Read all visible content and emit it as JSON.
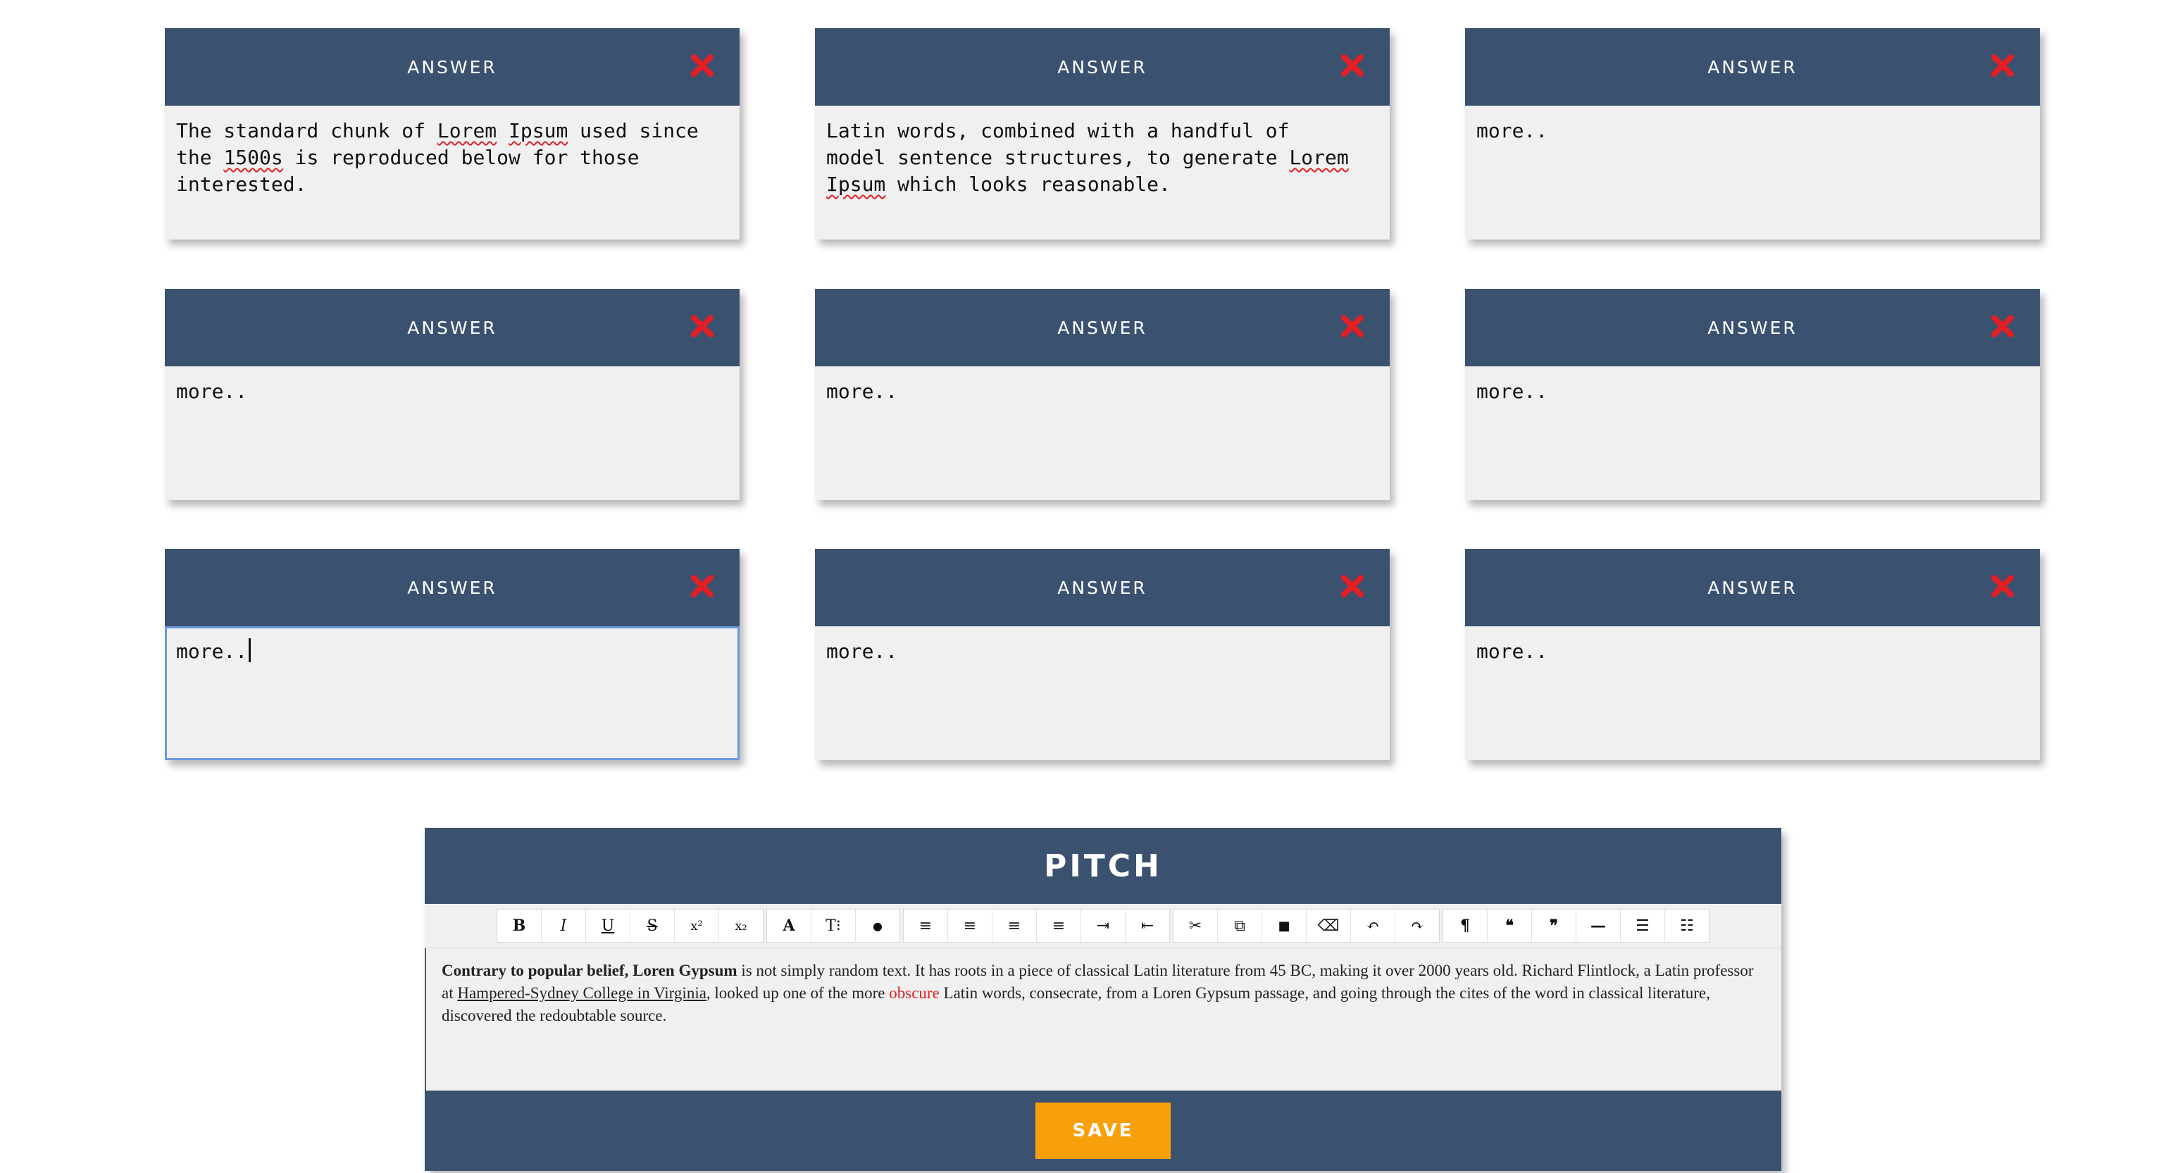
{
  "cards": [
    {
      "title": "ANSWER",
      "body_parts": [
        "The standard chunk of ",
        "Lorem",
        " ",
        "Ipsum",
        " used since\nthe ",
        "1500s",
        " is reproduced below for those\ninterested."
      ]
    },
    {
      "title": "ANSWER",
      "body_parts": [
        "Latin words, combined with a handful of\nmodel sentence structures, to generate ",
        "Lorem",
        "\n",
        "Ipsum",
        " which looks reasonable."
      ]
    },
    {
      "title": "ANSWER",
      "text": "more.."
    },
    {
      "title": "ANSWER",
      "text": "more.."
    },
    {
      "title": "ANSWER",
      "text": "more.."
    },
    {
      "title": "ANSWER",
      "text": "more.."
    },
    {
      "title": "ANSWER",
      "text": "more.."
    },
    {
      "title": "ANSWER",
      "text": "more.."
    },
    {
      "title": "ANSWER",
      "text": "more.."
    }
  ],
  "pitch": {
    "title": "PITCH",
    "body": {
      "bold": "Contrary to popular belief, Loren Gypsum",
      "text1": " is not simply random text. It has roots in a piece of classical Latin literature from 45 BC, making it over 2000 years old. Richard Flintlock, a Latin professor at ",
      "link": "Hampered-Sydney College in Virginia",
      "text2": ", looked up one of the more ",
      "red": "obscure",
      "text3": " Latin words, consecrate, from a Loren Gypsum passage, and going through the cites of the word in classical literature, discovered the redoubtable source."
    },
    "save_label": "SAVE"
  },
  "toolbar_icons": [
    [
      "bold-icon",
      "B"
    ],
    [
      "italic-icon",
      "I"
    ],
    [
      "underline-icon",
      "U"
    ],
    [
      "strikethrough-icon",
      "S"
    ],
    [
      "superscript-icon",
      "x²"
    ],
    [
      "subscript-icon",
      "x₂"
    ],
    [
      "font-color-icon",
      "A"
    ],
    [
      "text-size-icon",
      "T⁝"
    ],
    [
      "highlight-icon",
      "●"
    ],
    [
      "align-left-icon",
      "≡"
    ],
    [
      "align-center-icon",
      "≡"
    ],
    [
      "align-right-icon",
      "≡"
    ],
    [
      "justify-icon",
      "≡"
    ],
    [
      "indent-icon",
      "⇥"
    ],
    [
      "outdent-icon",
      "⇤"
    ],
    [
      "cut-icon",
      "✂"
    ],
    [
      "copy-icon",
      "⧉"
    ],
    [
      "delete-icon",
      "🗑"
    ],
    [
      "eraser-icon",
      "⌫"
    ],
    [
      "undo-icon",
      "↶"
    ],
    [
      "redo-icon",
      "↷"
    ],
    [
      "paragraph-icon",
      "¶"
    ],
    [
      "quote-open-icon",
      "❝"
    ],
    [
      "quote-close-icon",
      "❞"
    ],
    [
      "horizontal-rule-icon",
      "—"
    ],
    [
      "bullet-list-icon",
      "☰"
    ],
    [
      "numbered-list-icon",
      "☷"
    ]
  ],
  "colors": {
    "header": "#3a5170",
    "save": "#f7a00c",
    "close": "#e31e24"
  }
}
